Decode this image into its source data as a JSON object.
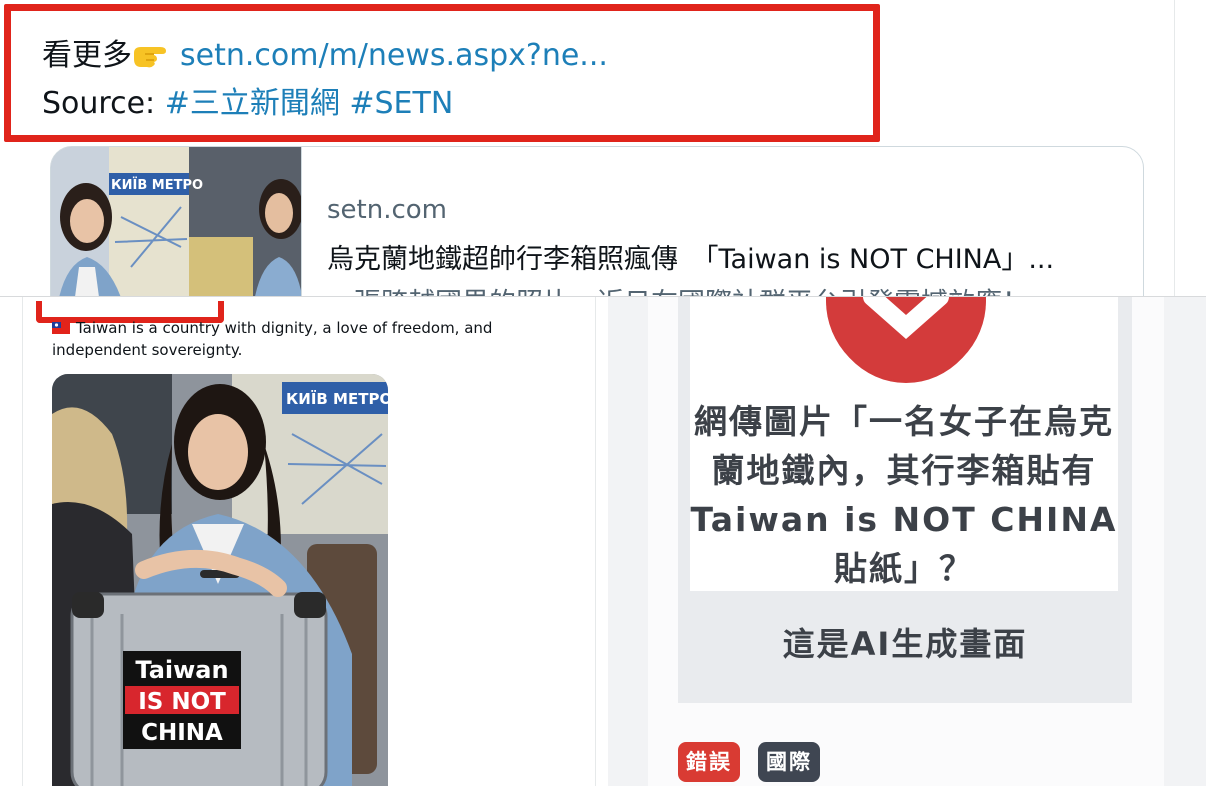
{
  "top": {
    "more_label": "看更多",
    "more_link": "setn.com/m/news.aspx?ne...",
    "source_label": "Source:",
    "source_tags": "#三立新聞網 #SETN",
    "card": {
      "domain": "setn.com",
      "title": "烏克蘭地鐵超帥行李箱照瘋傳　「Taiwan is NOT CHINA」...",
      "description": "一張跨越國界的照片，近日在國際社群平台引發震撼效應！一",
      "thumb_sign": "КИЇВ МЕТРО"
    }
  },
  "post": {
    "text": "Taiwan is a country with dignity, a love of freedom, and independent sovereignty.",
    "photo_sign": "КИЇВ МЕТРО",
    "sticker": [
      "Taiwan",
      "IS NOT",
      "CHINA"
    ]
  },
  "factcheck": {
    "headline": "網傳圖片「一名女子在烏克蘭地鐵內，其行李箱貼有 Taiwan is NOT CHINA 貼紙」？",
    "verdict": "這是AI生成畫面",
    "tags": [
      "錯誤",
      "國際"
    ]
  },
  "colors": {
    "highlight_red": "#e0241b",
    "link_blue": "#1d7fb8",
    "tag_red": "#d93b33",
    "tag_gray": "#3f4652"
  }
}
